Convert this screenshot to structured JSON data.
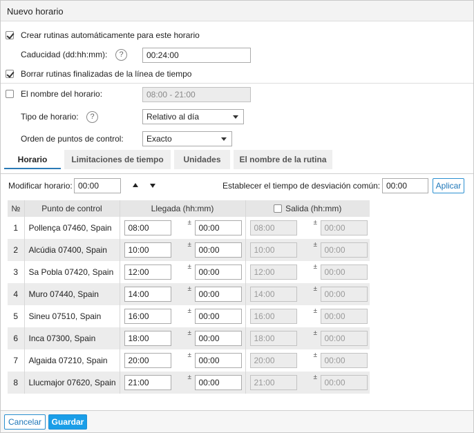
{
  "dialog": {
    "title": "Nuevo horario"
  },
  "options": {
    "auto_create": {
      "label": "Crear rutinas automáticamente para este horario",
      "checked": true
    },
    "expiry": {
      "label": "Caducidad (dd:hh:mm):",
      "value": "00:24:00",
      "help": "?"
    },
    "delete_finished": {
      "label": "Borrar rutinas finalizadas de la línea de tiempo",
      "checked": true
    },
    "schedule_name": {
      "label": "El nombre del horario:",
      "placeholder": "08:00 - 21:00",
      "checked": false
    },
    "schedule_type": {
      "label": "Tipo de horario:",
      "value": "Relativo al día",
      "help": "?"
    },
    "checkpoint_order": {
      "label": "Orden de puntos de control:",
      "value": "Exacto"
    }
  },
  "tabs": [
    {
      "label": "Horario",
      "active": true
    },
    {
      "label": "Limitaciones de tiempo",
      "active": false
    },
    {
      "label": "Unidades",
      "active": false
    },
    {
      "label": "El nombre de la rutina",
      "active": false
    }
  ],
  "toolbar": {
    "modify_label": "Modificar horario:",
    "modify_value": "00:00",
    "deviation_label": "Establecer el tiempo de desviación común:",
    "deviation_value": "00:00",
    "apply_label": "Aplicar"
  },
  "table": {
    "headers": {
      "num": "№",
      "point": "Punto de control",
      "arrival": "Llegada (hh:mm)",
      "departure": "Salida (hh:mm)"
    },
    "pm": "±",
    "rows": [
      {
        "num": "1",
        "point": "Pollença 07460, Spain",
        "arrival": "08:00",
        "arrival_dev": "00:00",
        "departure": "08:00",
        "departure_dev": "00:00"
      },
      {
        "num": "2",
        "point": "Alcúdia 07400, Spain",
        "arrival": "10:00",
        "arrival_dev": "00:00",
        "departure": "10:00",
        "departure_dev": "00:00"
      },
      {
        "num": "3",
        "point": "Sa Pobla 07420, Spain",
        "arrival": "12:00",
        "arrival_dev": "00:00",
        "departure": "12:00",
        "departure_dev": "00:00"
      },
      {
        "num": "4",
        "point": "Muro 07440, Spain",
        "arrival": "14:00",
        "arrival_dev": "00:00",
        "departure": "14:00",
        "departure_dev": "00:00"
      },
      {
        "num": "5",
        "point": "Sineu 07510, Spain",
        "arrival": "16:00",
        "arrival_dev": "00:00",
        "departure": "16:00",
        "departure_dev": "00:00"
      },
      {
        "num": "6",
        "point": "Inca 07300, Spain",
        "arrival": "18:00",
        "arrival_dev": "00:00",
        "departure": "18:00",
        "departure_dev": "00:00"
      },
      {
        "num": "7",
        "point": "Algaida 07210, Spain",
        "arrival": "20:00",
        "arrival_dev": "00:00",
        "departure": "20:00",
        "departure_dev": "00:00"
      },
      {
        "num": "8",
        "point": "Llucmajor 07620, Spain",
        "arrival": "21:00",
        "arrival_dev": "00:00",
        "departure": "21:00",
        "departure_dev": "00:00"
      }
    ]
  },
  "footer": {
    "cancel_label": "Cancelar",
    "save_label": "Guardar"
  }
}
